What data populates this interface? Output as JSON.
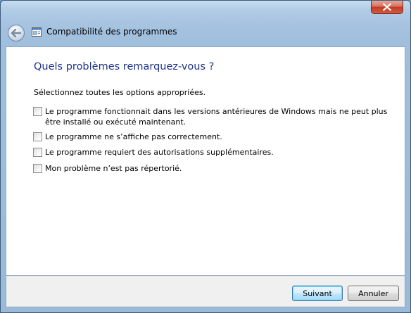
{
  "window": {
    "title": "Compatibilité des programmes"
  },
  "content": {
    "heading": "Quels problèmes remarquez-vous ?",
    "instruction": "Sélectionnez toutes les options appropriées.",
    "options": [
      {
        "label": "Le programme fonctionnait dans les versions antérieures de Windows mais ne peut plus être installé ou exécuté maintenant.",
        "checked": false
      },
      {
        "label": "Le programme ne s’affiche pas correctement.",
        "checked": false
      },
      {
        "label": "Le programme requiert des autorisations supplémentaires.",
        "checked": false
      },
      {
        "label": "Mon problème n’est pas répertorié.",
        "checked": false
      }
    ]
  },
  "footer": {
    "next_label": "Suivant",
    "cancel_label": "Annuler"
  },
  "icons": {
    "back": "back-arrow-icon",
    "close": "close-icon",
    "app": "program-window-icon"
  }
}
